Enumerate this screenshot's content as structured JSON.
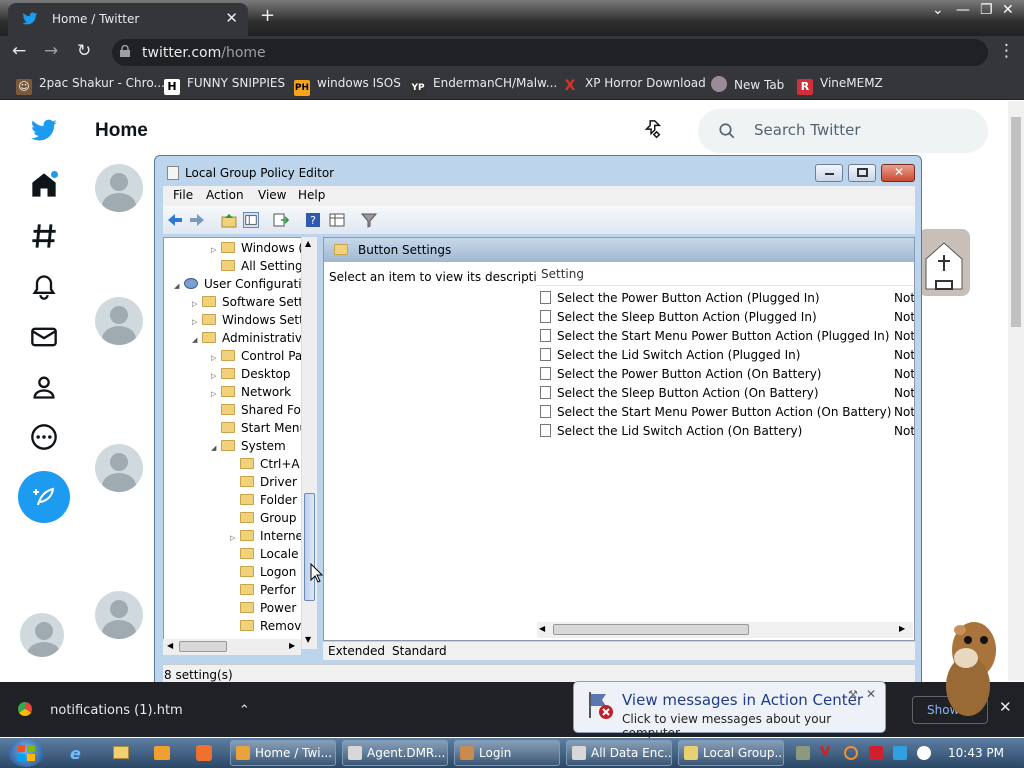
{
  "browser": {
    "tab_title": "Home / Twitter",
    "url_host": "twitter.com",
    "url_path": "/home",
    "bookmarks": [
      {
        "label": "2pac Shakur - Chro...",
        "icon": "face-icon"
      },
      {
        "label": "FUNNY SNIPPIES",
        "icon": "h-icon"
      },
      {
        "label": "windows ISOS",
        "icon": "ph-icon"
      },
      {
        "label": "EndermanCH/Malw...",
        "icon": "yp-icon"
      },
      {
        "label": "XP Horror Download",
        "icon": "x-icon"
      },
      {
        "label": "New Tab",
        "icon": "globe-icon"
      },
      {
        "label": "VineMEMZ",
        "icon": "r-icon"
      }
    ]
  },
  "twitter": {
    "title": "Home",
    "search_placeholder": "Search Twitter"
  },
  "gpedit": {
    "window_title": "Local Group Policy Editor",
    "menu": [
      "File",
      "Action",
      "View",
      "Help"
    ],
    "tree": [
      {
        "label": "Windows (",
        "level": 3,
        "expander": "▷"
      },
      {
        "label": "All Setting",
        "level": 3,
        "expander": ""
      },
      {
        "label": "User Configuratio",
        "level": 1,
        "expander": "◢"
      },
      {
        "label": "Software Setti",
        "level": 2,
        "expander": "▷"
      },
      {
        "label": "Windows Sett",
        "level": 2,
        "expander": "▷"
      },
      {
        "label": "Administrative",
        "level": 2,
        "expander": "◢"
      },
      {
        "label": "Control Pa",
        "level": 3,
        "expander": "▷"
      },
      {
        "label": "Desktop",
        "level": 3,
        "expander": "▷"
      },
      {
        "label": "Network",
        "level": 3,
        "expander": "▷"
      },
      {
        "label": "Shared Fol",
        "level": 3,
        "expander": ""
      },
      {
        "label": "Start Menu",
        "level": 3,
        "expander": ""
      },
      {
        "label": "System",
        "level": 3,
        "expander": "◢"
      },
      {
        "label": "Ctrl+A",
        "level": 4,
        "expander": ""
      },
      {
        "label": "Driver",
        "level": 4,
        "expander": ""
      },
      {
        "label": "Folder",
        "level": 4,
        "expander": ""
      },
      {
        "label": "Group",
        "level": 4,
        "expander": ""
      },
      {
        "label": "Interne",
        "level": 4,
        "expander": "▷"
      },
      {
        "label": "Locale",
        "level": 4,
        "expander": ""
      },
      {
        "label": "Logon",
        "level": 4,
        "expander": ""
      },
      {
        "label": "Perfor",
        "level": 4,
        "expander": ""
      },
      {
        "label": "Power",
        "level": 4,
        "expander": ""
      },
      {
        "label": "Remov",
        "level": 4,
        "expander": ""
      }
    ],
    "panel_title": "Button Settings",
    "description": "Select an item to view its description.",
    "column_setting": "Setting",
    "settings": [
      {
        "name": "Select the Power Button Action (Plugged In)",
        "state": "Not"
      },
      {
        "name": "Select the Sleep Button Action (Plugged In)",
        "state": "Not"
      },
      {
        "name": "Select the Start Menu Power Button Action (Plugged In)",
        "state": "Not"
      },
      {
        "name": "Select the Lid Switch Action (Plugged In)",
        "state": "Not"
      },
      {
        "name": "Select the Power Button Action (On Battery)",
        "state": "Not"
      },
      {
        "name": "Select the Sleep Button Action (On Battery)",
        "state": "Not"
      },
      {
        "name": "Select the Start Menu Power Button Action (On Battery)",
        "state": "Not"
      },
      {
        "name": "Select the Lid Switch Action (On Battery)",
        "state": "Not"
      }
    ],
    "tabs": [
      "Extended",
      "Standard"
    ],
    "status": "8 setting(s)"
  },
  "downloads": {
    "file": "notifications (1).htm",
    "show": "Show a"
  },
  "balloon": {
    "title": "View messages in Action Center",
    "subtitle": "Click to view messages about your computer."
  },
  "taskbar": {
    "items": [
      {
        "label": "Home / Twi...",
        "color": "#e8a33a"
      },
      {
        "label": "Agent.DMR...",
        "color": "#d8d8d8"
      },
      {
        "label": "Login",
        "color": "#c98a50"
      },
      {
        "label": "All Data Enc...",
        "color": "#d8d8d8"
      },
      {
        "label": "Local Group...",
        "color": "#e8d070"
      }
    ],
    "clock": "10:43 PM"
  },
  "colors": {
    "twitter_blue": "#1d9bf0",
    "chrome_dark": "#35363a"
  }
}
